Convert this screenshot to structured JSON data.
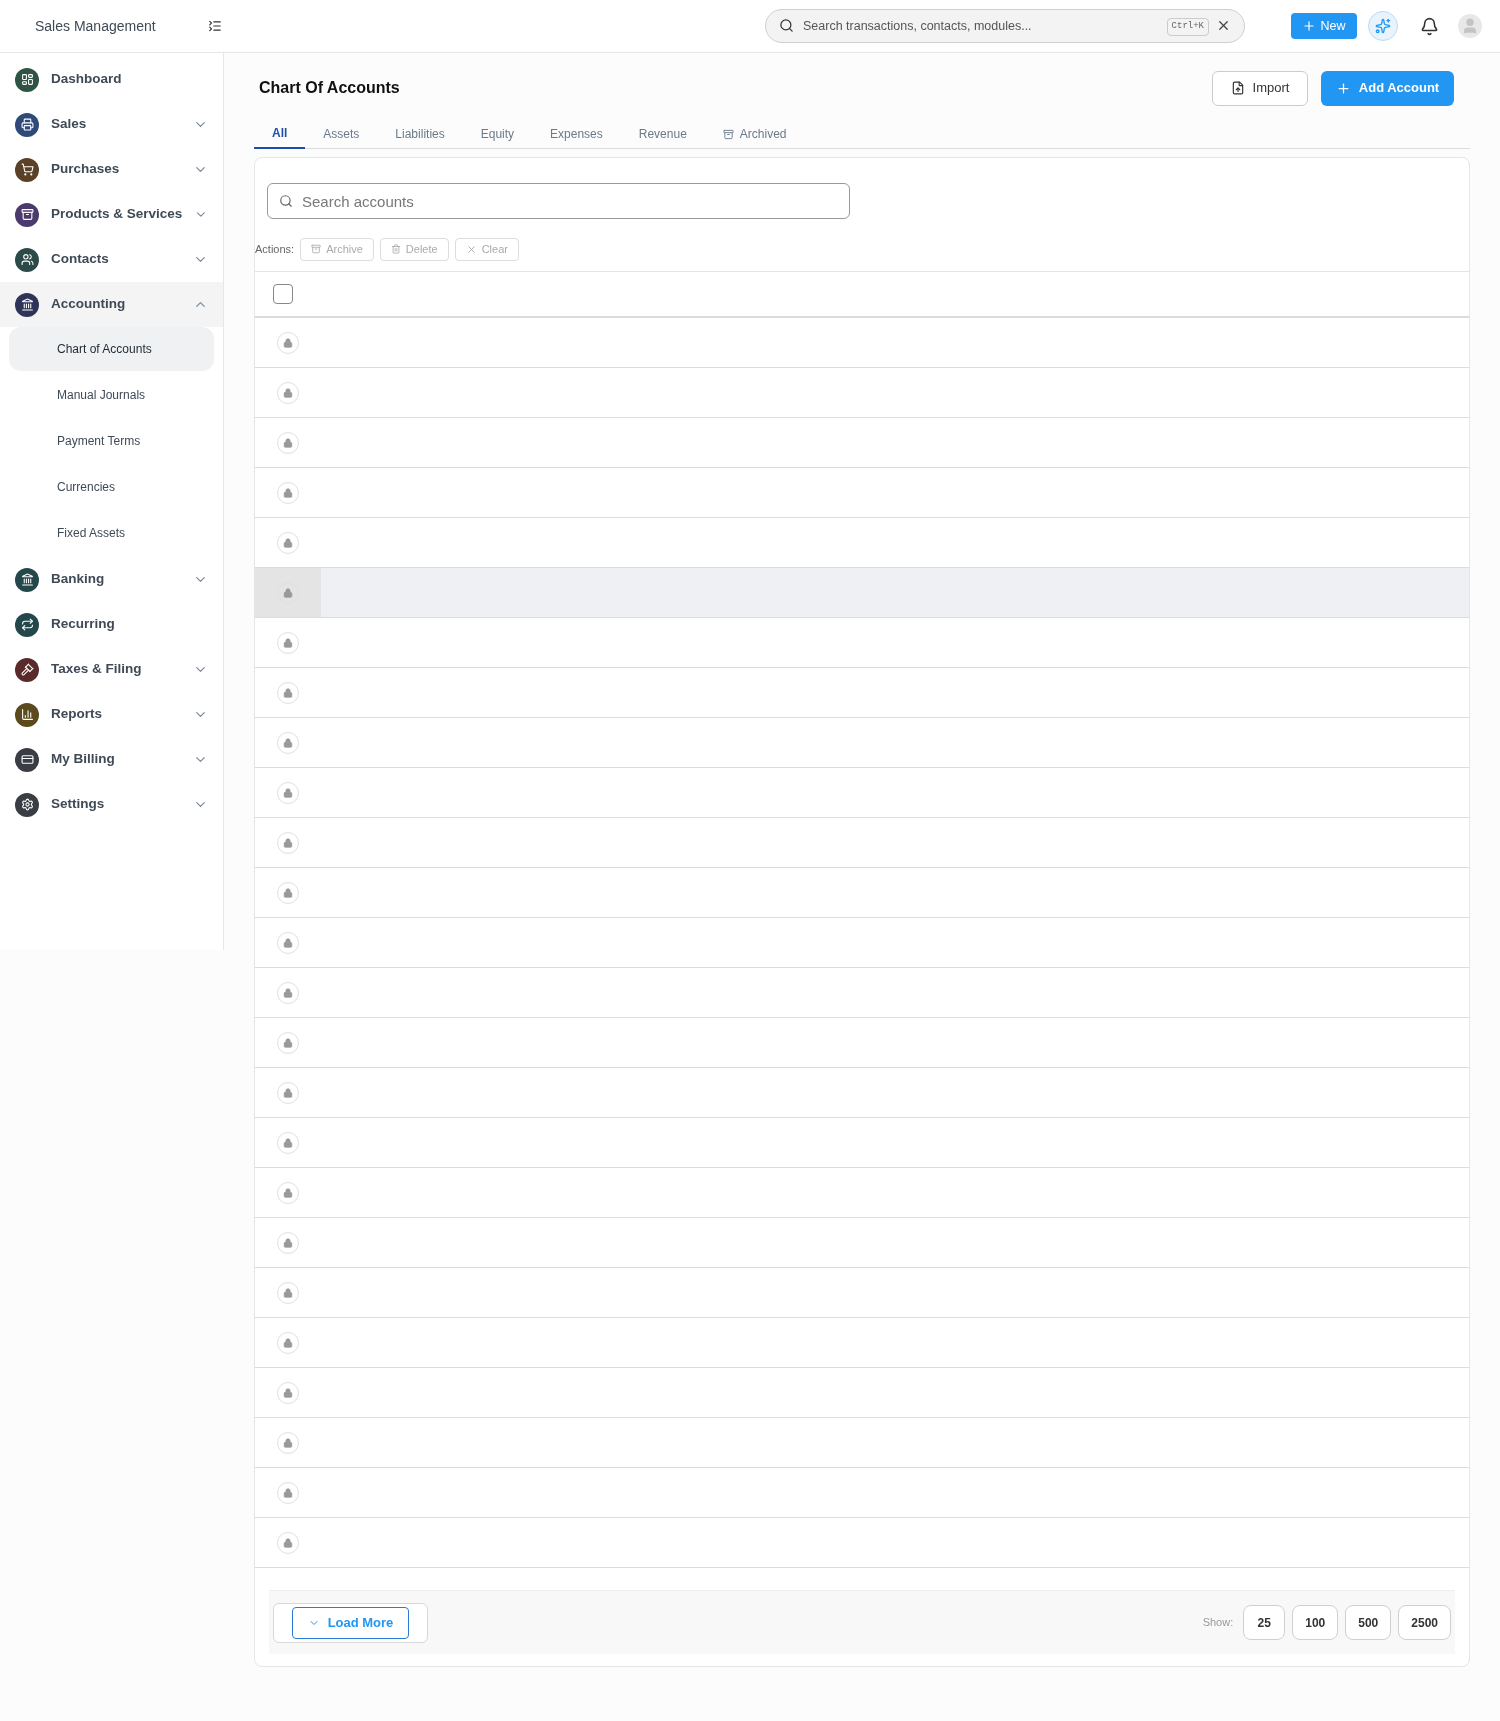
{
  "topbar": {
    "title": "Sales Management",
    "search": {
      "placeholder": "Search transactions, contacts, modules...",
      "shortcut": "Ctrl+K"
    },
    "new_button": "New"
  },
  "sidebar": {
    "items": [
      {
        "label": "Dashboard",
        "color": "#2f5443"
      },
      {
        "label": "Sales",
        "color": "#2f4a78",
        "expanded": false
      },
      {
        "label": "Purchases",
        "color": "#5a4026",
        "expanded": false
      },
      {
        "label": "Products & Services",
        "color": "#4a3a6e",
        "expanded": false
      },
      {
        "label": "Contacts",
        "color": "#2b4a48",
        "expanded": false
      },
      {
        "label": "Accounting",
        "color": "#2e3358",
        "expanded": true,
        "children": [
          {
            "label": "Chart of Accounts",
            "selected": true
          },
          {
            "label": "Manual Journals",
            "selected": false
          },
          {
            "label": "Payment Terms",
            "selected": false
          },
          {
            "label": "Currencies",
            "selected": false
          },
          {
            "label": "Fixed Assets",
            "selected": false
          }
        ]
      },
      {
        "label": "Banking",
        "color": "#24484a",
        "expanded": false
      },
      {
        "label": "Recurring",
        "color": "#23474a"
      },
      {
        "label": "Taxes & Filing",
        "color": "#5a2a2a",
        "expanded": false
      },
      {
        "label": "Reports",
        "color": "#5a4a1e",
        "expanded": false
      },
      {
        "label": "My Billing",
        "color": "#3a3d44",
        "expanded": false
      },
      {
        "label": "Settings",
        "color": "#3a3d44",
        "expanded": false
      }
    ]
  },
  "page": {
    "title": "Chart Of Accounts",
    "import_button": "Import",
    "add_button": "Add Account"
  },
  "tabs": [
    {
      "label": "All",
      "selected": true
    },
    {
      "label": "Assets",
      "selected": false
    },
    {
      "label": "Liabilities",
      "selected": false
    },
    {
      "label": "Equity",
      "selected": false
    },
    {
      "label": "Expenses",
      "selected": false
    },
    {
      "label": "Revenue",
      "selected": false
    },
    {
      "label": "Archived",
      "selected": false,
      "kind": "archive"
    }
  ],
  "search": {
    "placeholder": "Search accounts"
  },
  "actions": {
    "label": "Actions:",
    "buttons": [
      {
        "label": "Archive",
        "kind": "archive",
        "disabled": true
      },
      {
        "label": "Delete",
        "kind": "delete",
        "disabled": true
      },
      {
        "label": "Clear",
        "kind": "clear",
        "disabled": true
      }
    ]
  },
  "table": {
    "select_all_checked": false,
    "rows": [
      {
        "locked": true,
        "highlighted": false
      },
      {
        "locked": true,
        "highlighted": false
      },
      {
        "locked": true,
        "highlighted": false
      },
      {
        "locked": true,
        "highlighted": false
      },
      {
        "locked": true,
        "highlighted": false
      },
      {
        "locked": true,
        "highlighted": true
      },
      {
        "locked": true,
        "highlighted": false
      },
      {
        "locked": true,
        "highlighted": false
      },
      {
        "locked": true,
        "highlighted": false
      },
      {
        "locked": true,
        "highlighted": false
      },
      {
        "locked": true,
        "highlighted": false
      },
      {
        "locked": true,
        "highlighted": false
      },
      {
        "locked": true,
        "highlighted": false
      },
      {
        "locked": true,
        "highlighted": false
      },
      {
        "locked": true,
        "highlighted": false
      },
      {
        "locked": true,
        "highlighted": false
      },
      {
        "locked": true,
        "highlighted": false
      },
      {
        "locked": true,
        "highlighted": false
      },
      {
        "locked": true,
        "highlighted": false
      },
      {
        "locked": true,
        "highlighted": false
      },
      {
        "locked": true,
        "highlighted": false
      },
      {
        "locked": true,
        "highlighted": false
      },
      {
        "locked": true,
        "highlighted": false
      },
      {
        "locked": true,
        "highlighted": false
      },
      {
        "locked": true,
        "highlighted": false
      }
    ]
  },
  "footer": {
    "load_more": "Load More",
    "show_label": "Show:",
    "page_sizes": [
      "25",
      "100",
      "500",
      "2500"
    ]
  }
}
